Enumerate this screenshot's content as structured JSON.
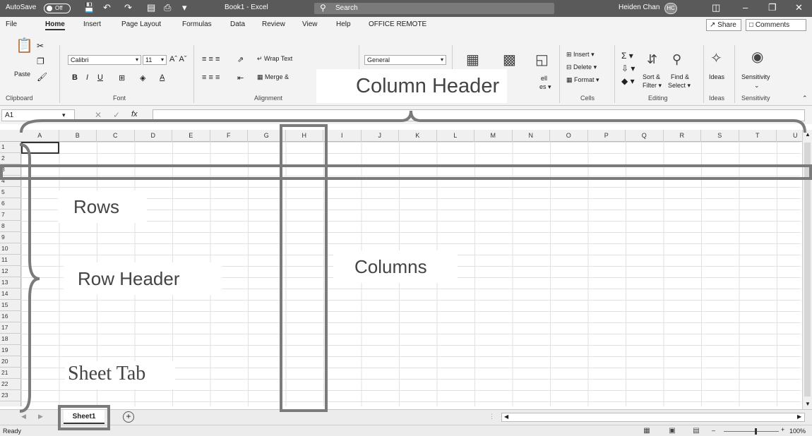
{
  "window": {
    "autosave_label": "AutoSave",
    "autosave_state": "Off",
    "doc_title": "Book1 - Excel",
    "search_placeholder": "Search",
    "user_name": "Heiden Chan",
    "user_initials": "HC"
  },
  "menu": {
    "tabs": [
      "File",
      "Home",
      "Insert",
      "Page Layout",
      "Formulas",
      "Data",
      "Review",
      "View",
      "Help",
      "OFFICE REMOTE"
    ],
    "share_label": "Share",
    "comments_label": "Comments"
  },
  "ribbon": {
    "paste_label": "Paste",
    "font_name": "Calibri",
    "font_size": "11",
    "wrap_text_label": "Wrap Text",
    "merge_label": "Merge &",
    "number_format": "General",
    "cell_styles_partial": "ell",
    "cell_styles_partial2": "es",
    "insert_label": "Insert",
    "delete_label": "Delete",
    "format_label": "Format",
    "sort_filter_label": "Sort &",
    "sort_filter_label2": "Filter",
    "find_select_label": "Find &",
    "find_select_label2": "Select",
    "ideas_label": "Ideas",
    "sensitivity_label": "Sensitivity",
    "groups": {
      "clipboard": "Clipboard",
      "font": "Font",
      "alignment": "Alignment",
      "cells": "Cells",
      "editing": "Editing",
      "ideas": "Ideas",
      "sensitivity": "Sensitivity"
    }
  },
  "formula_bar": {
    "name_box": "A1",
    "fx": "fx"
  },
  "grid": {
    "columns": [
      "A",
      "B",
      "C",
      "D",
      "E",
      "F",
      "G",
      "H",
      "I",
      "J",
      "K",
      "L",
      "M",
      "N",
      "O",
      "P",
      "Q",
      "R",
      "S",
      "T",
      "U"
    ],
    "rows": [
      "1",
      "2",
      "3",
      "4",
      "5",
      "6",
      "7",
      "8",
      "9",
      "10",
      "11",
      "12",
      "13",
      "14",
      "15",
      "16",
      "17",
      "18",
      "19",
      "20",
      "21",
      "22",
      "23"
    ]
  },
  "sheet": {
    "tab_name": "Sheet1"
  },
  "status": {
    "text": "Ready",
    "zoom": "100%"
  },
  "annotations": {
    "column_header": "Column Header",
    "rows": "Rows",
    "row_header": "Row Header",
    "columns": "Columns",
    "sheet_tab": "Sheet Tab"
  }
}
